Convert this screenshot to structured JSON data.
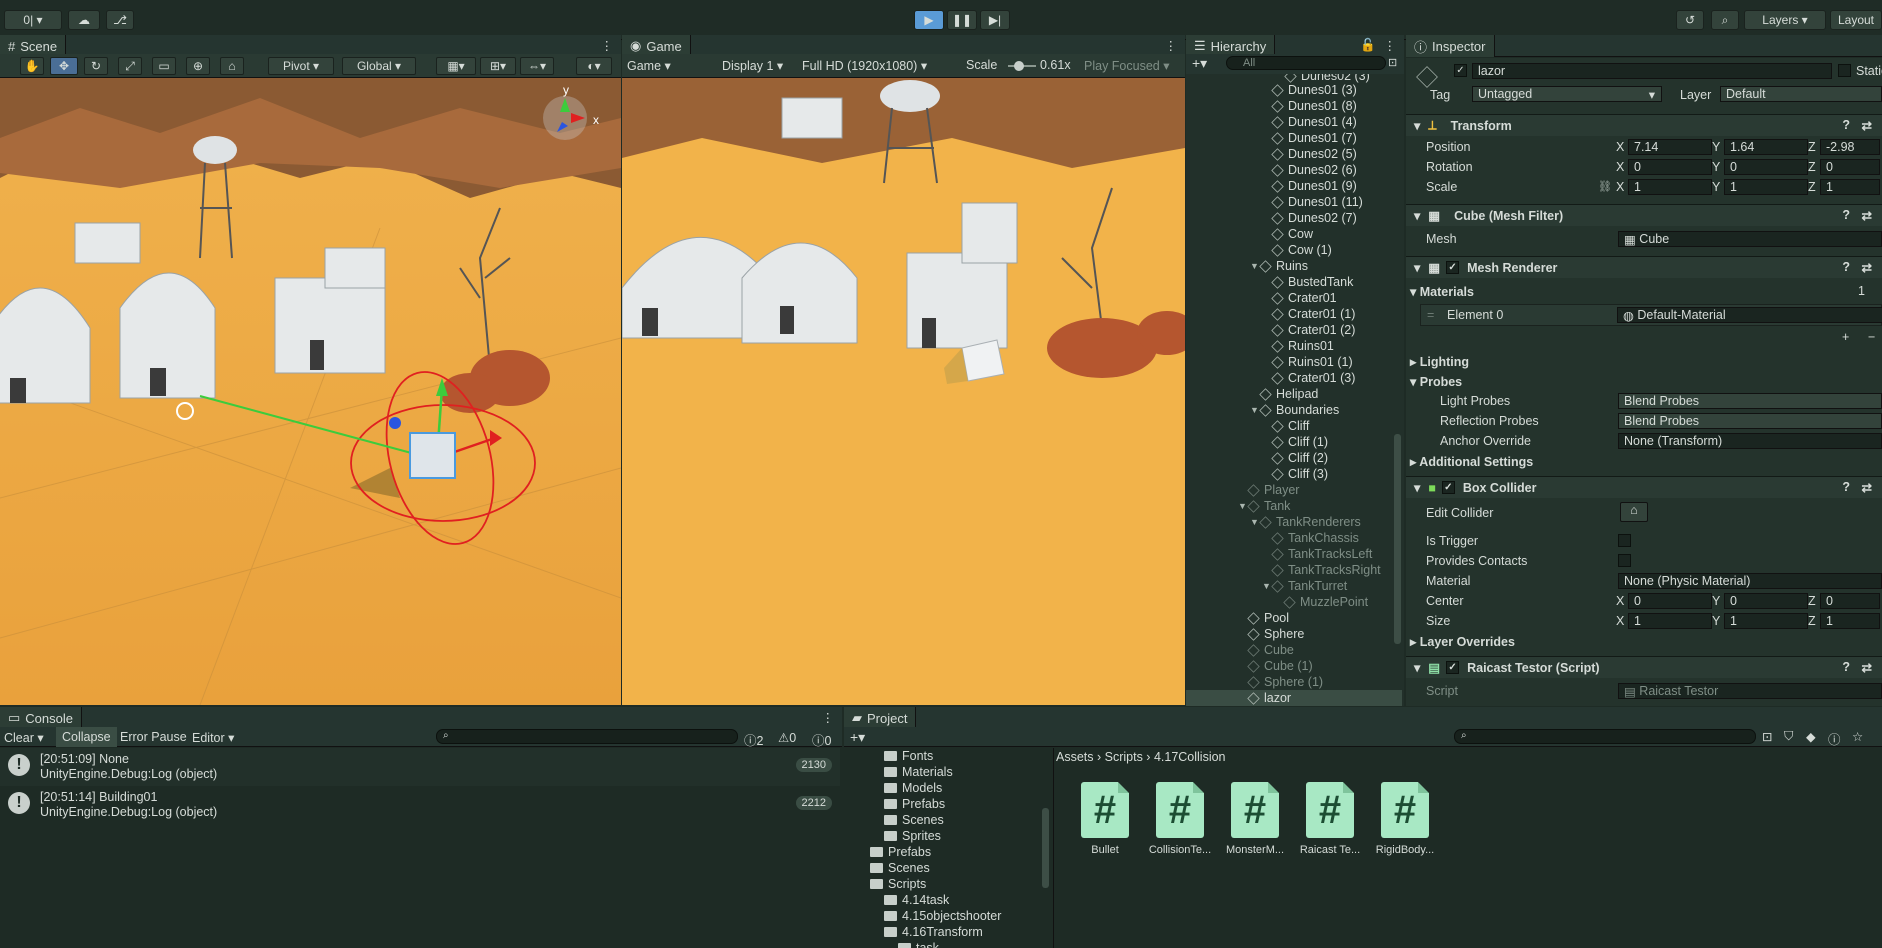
{
  "topbar": {
    "account": "0|",
    "layers": "Layers",
    "layout": "Layout"
  },
  "scene": {
    "tab": "Scene",
    "pivot": "Pivot",
    "global": "Global"
  },
  "game": {
    "tab": "Game",
    "mode": "Game",
    "display": "Display 1",
    "resolution": "Full HD (1920x1080)",
    "scale_label": "Scale",
    "scale_value": "0.61x",
    "play_focused": "Play Focused"
  },
  "hierarchy": {
    "tab": "Hierarchy",
    "search_placeholder": "All",
    "items": [
      {
        "label": "Dunes01 (3)",
        "indent": 1,
        "dim": false
      },
      {
        "label": "Dunes01 (8)",
        "indent": 1,
        "dim": false
      },
      {
        "label": "Dunes01 (4)",
        "indent": 1,
        "dim": false
      },
      {
        "label": "Dunes01 (7)",
        "indent": 1,
        "dim": false
      },
      {
        "label": "Dunes02 (5)",
        "indent": 1,
        "dim": false
      },
      {
        "label": "Dunes02 (6)",
        "indent": 1,
        "dim": false
      },
      {
        "label": "Dunes01 (9)",
        "indent": 1,
        "dim": false
      },
      {
        "label": "Dunes01 (11)",
        "indent": 1,
        "dim": false
      },
      {
        "label": "Dunes02 (7)",
        "indent": 1,
        "dim": false
      },
      {
        "label": "Cow",
        "indent": 1,
        "dim": false
      },
      {
        "label": "Cow (1)",
        "indent": 1,
        "dim": false
      },
      {
        "label": "Ruins",
        "indent": 0.5,
        "dim": false,
        "expanded": true
      },
      {
        "label": "BustedTank",
        "indent": 1,
        "dim": false
      },
      {
        "label": "Crater01",
        "indent": 1,
        "dim": false
      },
      {
        "label": "Crater01 (1)",
        "indent": 1,
        "dim": false
      },
      {
        "label": "Crater01 (2)",
        "indent": 1,
        "dim": false
      },
      {
        "label": "Ruins01",
        "indent": 1,
        "dim": false
      },
      {
        "label": "Ruins01 (1)",
        "indent": 1,
        "dim": false
      },
      {
        "label": "Crater01 (3)",
        "indent": 1,
        "dim": false
      },
      {
        "label": "Helipad",
        "indent": 0.5,
        "dim": false
      },
      {
        "label": "Boundaries",
        "indent": 0.5,
        "dim": false,
        "expanded": true
      },
      {
        "label": "Cliff",
        "indent": 1,
        "dim": false
      },
      {
        "label": "Cliff (1)",
        "indent": 1,
        "dim": false
      },
      {
        "label": "Cliff (2)",
        "indent": 1,
        "dim": false
      },
      {
        "label": "Cliff (3)",
        "indent": 1,
        "dim": false
      },
      {
        "label": "Player",
        "indent": 0,
        "dim": true
      },
      {
        "label": "Tank",
        "indent": 0,
        "dim": true,
        "expanded": true
      },
      {
        "label": "TankRenderers",
        "indent": 0.5,
        "dim": true,
        "expanded": true
      },
      {
        "label": "TankChassis",
        "indent": 1,
        "dim": true
      },
      {
        "label": "TankTracksLeft",
        "indent": 1,
        "dim": true
      },
      {
        "label": "TankTracksRight",
        "indent": 1,
        "dim": true
      },
      {
        "label": "TankTurret",
        "indent": 1,
        "dim": true,
        "expanded": true
      },
      {
        "label": "MuzzlePoint",
        "indent": 1.5,
        "dim": true
      },
      {
        "label": "Pool",
        "indent": 0,
        "dim": false
      },
      {
        "label": "Sphere",
        "indent": 0,
        "dim": false
      },
      {
        "label": "Cube",
        "indent": 0,
        "dim": true
      },
      {
        "label": "Cube (1)",
        "indent": 0,
        "dim": true
      },
      {
        "label": "Sphere (1)",
        "indent": 0,
        "dim": true
      },
      {
        "label": "lazor",
        "indent": 0,
        "dim": false,
        "selected": true
      }
    ]
  },
  "inspector": {
    "tab": "Inspector",
    "object_name": "lazor",
    "static": "Static",
    "tag_label": "Tag",
    "tag_value": "Untagged",
    "layer_label": "Layer",
    "layer_value": "Default",
    "transform": {
      "title": "Transform",
      "position": "Position",
      "rotation": "Rotation",
      "scale": "Scale",
      "pos": [
        "7.14",
        "1.64",
        "-2.98"
      ],
      "rot": [
        "0",
        "0",
        "0"
      ],
      "scl": [
        "1",
        "1",
        "1"
      ]
    },
    "mesh_filter": {
      "title": "Cube (Mesh Filter)",
      "mesh_label": "Mesh",
      "mesh_value": "Cube"
    },
    "mesh_renderer": {
      "title": "Mesh Renderer",
      "materials": "Materials",
      "materials_count": "1",
      "element0": "Element 0",
      "element0_value": "Default-Material",
      "lighting": "Lighting",
      "probes": "Probes",
      "light_probes": "Light Probes",
      "light_probes_value": "Blend Probes",
      "reflection_probes": "Reflection Probes",
      "reflection_probes_value": "Blend Probes",
      "anchor_override": "Anchor Override",
      "anchor_override_value": "None (Transform)",
      "additional": "Additional Settings"
    },
    "box_collider": {
      "title": "Box Collider",
      "edit_collider": "Edit Collider",
      "is_trigger": "Is Trigger",
      "provides_contacts": "Provides Contacts",
      "material": "Material",
      "material_value": "None (Physic Material)",
      "center": "Center",
      "center_v": [
        "0",
        "0",
        "0"
      ],
      "size": "Size",
      "size_v": [
        "1",
        "1",
        "1"
      ],
      "layer_overrides": "Layer Overrides"
    },
    "script": {
      "title": "Raicast Testor (Script)",
      "script_label": "Script",
      "script_value": "Raicast Testor"
    }
  },
  "console": {
    "tab": "Console",
    "clear": "Clear",
    "collapse": "Collapse",
    "error_pause": "Error Pause",
    "editor": "Editor",
    "counts": [
      "2",
      "0",
      "0"
    ],
    "logs": [
      {
        "line1": "[20:51:09] None",
        "line2": "UnityEngine.Debug:Log (object)",
        "count": "2130"
      },
      {
        "line1": "[20:51:14] Building01",
        "line2": "UnityEngine.Debug:Log (object)",
        "count": "2212"
      }
    ]
  },
  "project": {
    "tab": "Project",
    "breadcrumb": [
      "Assets",
      "Scripts",
      "4.17Collision"
    ],
    "tree": [
      {
        "label": "Fonts",
        "indent": 2
      },
      {
        "label": "Materials",
        "indent": 2
      },
      {
        "label": "Models",
        "indent": 2
      },
      {
        "label": "Prefabs",
        "indent": 2
      },
      {
        "label": "Scenes",
        "indent": 2
      },
      {
        "label": "Sprites",
        "indent": 2
      },
      {
        "label": "Prefabs",
        "indent": 1
      },
      {
        "label": "Scenes",
        "indent": 1
      },
      {
        "label": "Scripts",
        "indent": 1
      },
      {
        "label": "4.14task",
        "indent": 2
      },
      {
        "label": "4.15objectshooter",
        "indent": 2
      },
      {
        "label": "4.16Transform",
        "indent": 2
      },
      {
        "label": "task",
        "indent": 3
      }
    ],
    "assets": [
      "Bullet",
      "CollisionTe...",
      "MonsterM...",
      "Raicast Te...",
      "RigidBody..."
    ]
  }
}
